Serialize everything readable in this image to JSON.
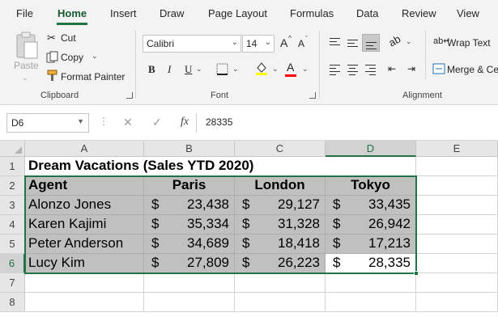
{
  "tabs": [
    "File",
    "Home",
    "Insert",
    "Draw",
    "Page Layout",
    "Formulas",
    "Data",
    "Review",
    "View"
  ],
  "active_tab": "Home",
  "clipboard": {
    "paste_label": "Paste",
    "cut_label": "Cut",
    "copy_label": "Copy",
    "format_painter_label": "Format Painter",
    "group_label": "Clipboard"
  },
  "font": {
    "name": "Calibri",
    "size": "14",
    "bold": "B",
    "italic": "I",
    "underline": "U",
    "grow": "A",
    "shrink": "A",
    "font_color_letter": "A",
    "group_label": "Font",
    "fill_color": "#ffff00",
    "font_color": "#ff0000"
  },
  "alignment": {
    "wrap_text_label": "Wrap Text",
    "merge_label": "Merge & Ce",
    "group_label": "Alignment"
  },
  "formula_bar": {
    "name_box": "D6",
    "cancel": "✕",
    "enter": "✓",
    "fx": "fx",
    "value": "28335"
  },
  "columns": [
    "A",
    "B",
    "C",
    "D",
    "E"
  ],
  "selected_column": "D",
  "rows": [
    "1",
    "2",
    "3",
    "4",
    "5",
    "6",
    "7",
    "8"
  ],
  "selected_row": "6",
  "sheet": {
    "title": "Dream Vacations (Sales YTD 2020)",
    "headers": [
      "Agent",
      "Paris",
      "London",
      "Tokyo"
    ],
    "currency": "$",
    "data": [
      {
        "agent": "Alonzo Jones",
        "paris": "23,438",
        "london": "29,127",
        "tokyo": "33,435"
      },
      {
        "agent": "Karen Kajimi",
        "paris": "35,334",
        "london": "31,328",
        "tokyo": "26,942"
      },
      {
        "agent": "Peter Anderson",
        "paris": "34,689",
        "london": "18,418",
        "tokyo": "17,213"
      },
      {
        "agent": "Lucy Kim",
        "paris": "27,809",
        "london": "26,223",
        "tokyo": "28,335"
      }
    ]
  },
  "colors": {
    "accent": "#217346",
    "shade": "#c0c0c0"
  }
}
